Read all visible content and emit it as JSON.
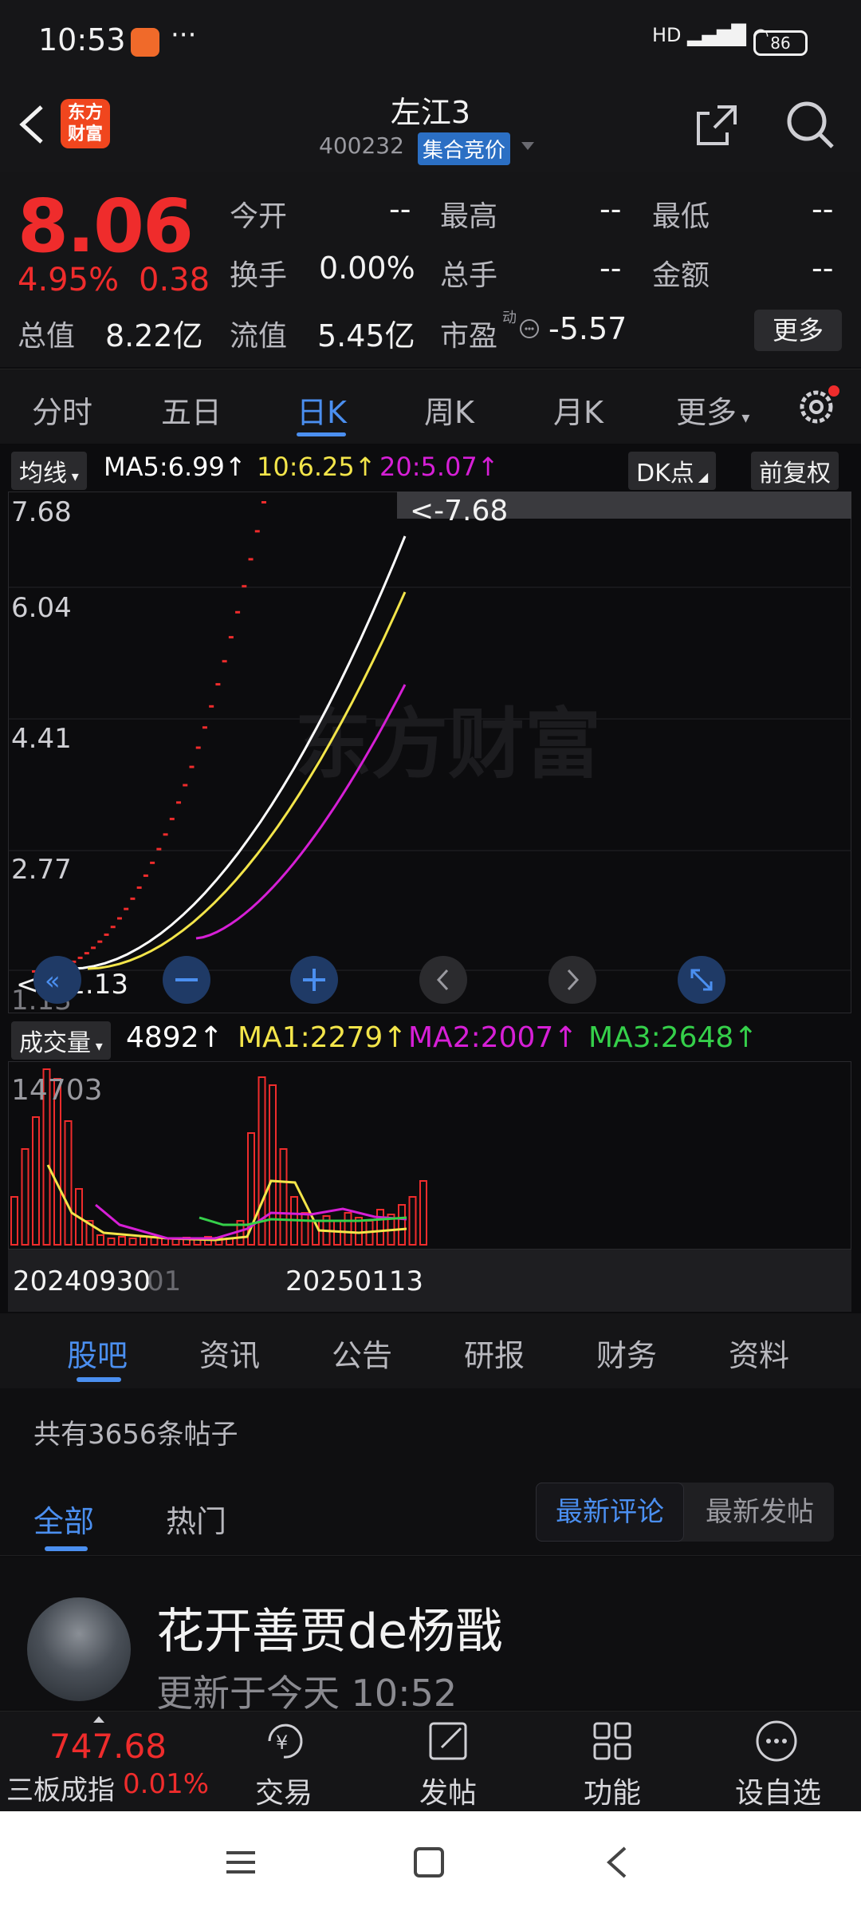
{
  "status": {
    "time": "10:53",
    "more": "···",
    "signal": "HD",
    "battery": "86"
  },
  "header": {
    "stock_name": "左江3",
    "stock_code": "400232",
    "auction_tag": "集合竞价",
    "logo_text_1": "东方",
    "logo_text_2": "财富"
  },
  "quote": {
    "price": "8.06",
    "pct": "4.95%",
    "change": "0.38",
    "open_label": "今开",
    "open": "--",
    "high_label": "最高",
    "high": "--",
    "low_label": "最低",
    "low": "--",
    "turnover_label": "换手",
    "turnover": "0.00%",
    "volume_label": "总手",
    "volume": "--",
    "amount_label": "金额",
    "amount": "--",
    "mktcap_label": "总值",
    "mktcap": "8.22亿",
    "float_label": "流值",
    "float_val": "5.45亿",
    "pe_label": "市盈",
    "pe_sup": "动",
    "pe": "-5.57",
    "more_button": "更多"
  },
  "period_tabs": [
    "分时",
    "五日",
    "日K",
    "周K",
    "月K",
    "更多"
  ],
  "kchart": {
    "indicator": "均线",
    "ma5": "MA5:6.99",
    "ma10": "10:6.25",
    "ma20": "20:5.07",
    "dk_button": "DK点",
    "adjust_button": "前复权",
    "y_labels": [
      "7.68",
      "6.04",
      "4.41",
      "2.77",
      "1.13"
    ],
    "max_marker": "<-7.68",
    "min_marker": "<---1.13",
    "watermark": "东方财富"
  },
  "volume": {
    "indicator": "成交量",
    "vol": "4892",
    "ma1": "MA1:2279",
    "ma2": "MA2:2007",
    "ma3": "MA3:2648",
    "y_max": "14703",
    "x_labels": [
      "20240930",
      "01",
      "20250113"
    ]
  },
  "chart_data": {
    "type": "candlestick",
    "y_range": [
      1.13,
      7.68
    ],
    "ma_values": {
      "MA5": 6.99,
      "MA10": 6.25,
      "MA20": 5.07
    },
    "volume_max": 14703
  },
  "colors": {
    "up": "#ef2c2c",
    "accent": "#4b8ff0",
    "ma5": "#ffffff",
    "ma10": "#f3e54a",
    "ma20": "#d61fd6",
    "ma3": "#35d04a"
  },
  "sub_tabs": [
    "股吧",
    "资讯",
    "公告",
    "研报",
    "财务",
    "资料"
  ],
  "posts": {
    "count_text": "共有3656条帖子",
    "filter_all": "全部",
    "filter_hot": "热门",
    "sort_latest_comment": "最新评论",
    "sort_latest_post": "最新发帖",
    "author": "花开善贾de杨戬",
    "updated": "更新于今天 10:52"
  },
  "bottom_nav": {
    "index_value": "747.68",
    "index_name": "三板成指",
    "index_pct": "0.01%",
    "trade": "交易",
    "post": "发帖",
    "func": "功能",
    "watch": "设自选"
  }
}
